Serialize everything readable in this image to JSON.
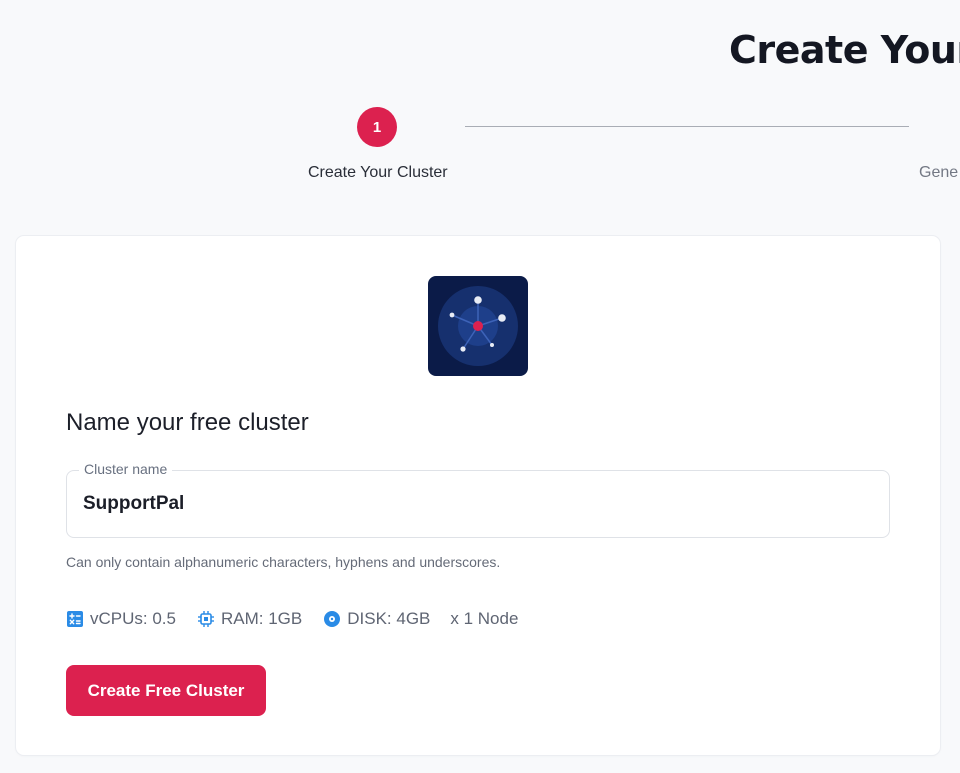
{
  "header": {
    "title": "Create Your"
  },
  "stepper": {
    "steps": [
      {
        "number": "1",
        "label": "Create Your Cluster",
        "state": "active"
      },
      {
        "label": "Gene",
        "state": "upcoming"
      }
    ]
  },
  "card": {
    "logo_icon": "cluster-network-icon",
    "heading": "Name your free cluster",
    "cluster_field": {
      "legend": "Cluster name",
      "value": "SupportPal"
    },
    "helper": "Can only contain alphanumeric characters, hyphens and underscores.",
    "specs": {
      "vcpu": "vCPUs: 0.5",
      "ram": "RAM: 1GB",
      "disk": "DISK: 4GB",
      "nodes": "x 1 Node"
    },
    "create_button": "Create Free Cluster"
  },
  "colors": {
    "accent": "#dc214f",
    "icon_blue": "#2a8be6",
    "logo_bg": "#0b1b48"
  }
}
